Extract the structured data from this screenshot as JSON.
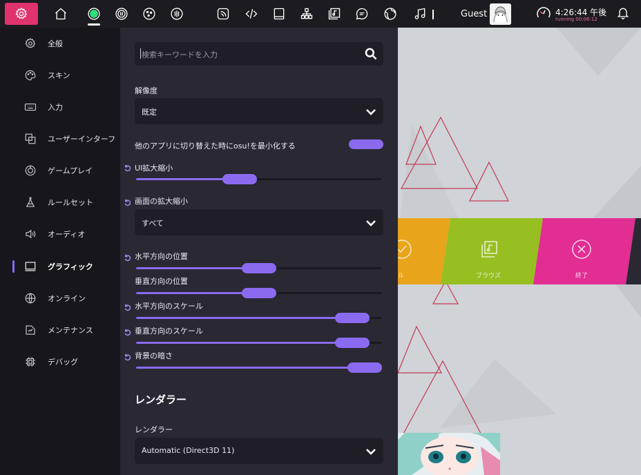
{
  "toolbar": {
    "icons": [
      "gear-icon",
      "home-icon",
      "circle-record-icon",
      "pause-ring-icon",
      "dice-icon",
      "bars-icon",
      "rss-icon",
      "code-icon",
      "book-icon",
      "hierarchy-icon",
      "music-sheet-icon",
      "chat-icon",
      "globe-icon",
      "music-note-icon"
    ],
    "user_name": "Guest",
    "time": "4:26:44 午後",
    "running": "running 00:06:12"
  },
  "sidebar": {
    "items": [
      {
        "label": "全般",
        "icon": "gear-icon"
      },
      {
        "label": "スキン",
        "icon": "palette-icon"
      },
      {
        "label": "入力",
        "icon": "keyboard-icon"
      },
      {
        "label": "ユーザーインターフ",
        "icon": "windows-icon"
      },
      {
        "label": "ゲームプレイ",
        "icon": "gameplay-icon"
      },
      {
        "label": "ルールセット",
        "icon": "flask-icon"
      },
      {
        "label": "オーディオ",
        "icon": "speaker-icon"
      },
      {
        "label": "グラフィック",
        "icon": "monitor-icon"
      },
      {
        "label": "オンライン",
        "icon": "globe-icon"
      },
      {
        "label": "メンテナンス",
        "icon": "maintenance-icon"
      },
      {
        "label": "デバッグ",
        "icon": "chip-icon"
      }
    ],
    "active_index": 7
  },
  "panel": {
    "search_placeholder": "検索キーワードを入力",
    "resolution_label": "解像度",
    "resolution_value": "既定",
    "minimize_label": "他のアプリに切り替えた時にosu!を最小化する",
    "ui_scale_label": "UI拡大縮小",
    "screen_scale_label": "画面の拡大縮小",
    "screen_scale_value": "すべて",
    "h_position_label": "水平方向の位置",
    "v_position_label": "垂直方向の位置",
    "h_scale_label": "水平方向のスケール",
    "v_scale_label": "垂直方向のスケール",
    "dim_label": "背景の暗さ",
    "renderer_section": "レンダラー",
    "renderer_label": "レンダラー",
    "renderer_value": "Automatic (Direct3D 11)"
  },
  "sliders": {
    "ui_scale": 0.42,
    "h_position": 0.5,
    "v_position": 0.5,
    "h_scale": 0.88,
    "v_scale": 0.88,
    "dim": 1.0
  },
  "menu": {
    "browse_label": "ブラウズ",
    "exit_label": "終了",
    "play_label_partial": "ル"
  },
  "colors": {
    "accent": "#8a6bf0",
    "settings_button": "#e0336e",
    "menu_orange": "#e8a51b",
    "menu_green": "#97bf22",
    "menu_pink": "#e22d93"
  }
}
